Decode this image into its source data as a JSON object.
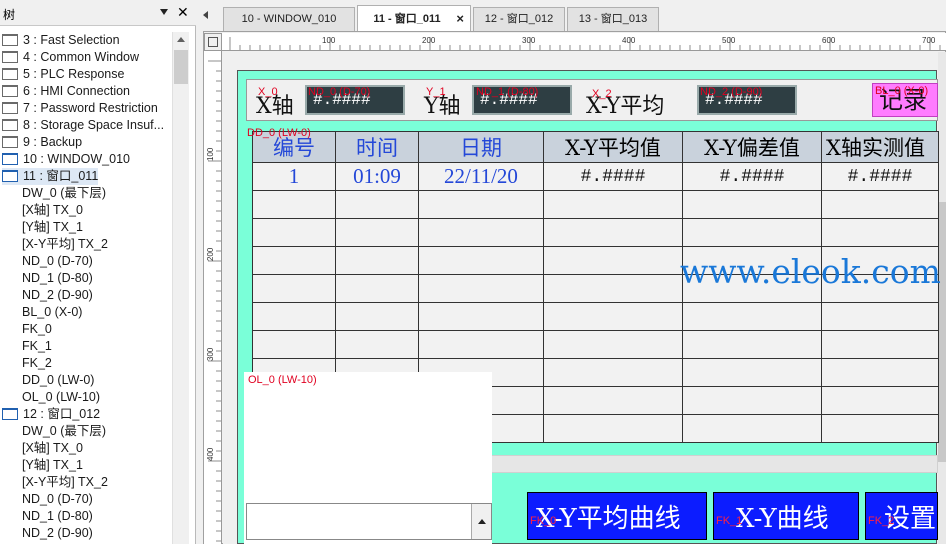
{
  "tree": {
    "title": "树",
    "items": [
      {
        "label": "3 : Fast Selection",
        "level": 0
      },
      {
        "label": "4 : Common Window",
        "level": 0
      },
      {
        "label": "5 : PLC Response",
        "level": 0
      },
      {
        "label": "6 : HMI Connection",
        "level": 0
      },
      {
        "label": "7 : Password Restriction",
        "level": 0
      },
      {
        "label": "8 : Storage Space Insuf...",
        "level": 0
      },
      {
        "label": "9 : Backup",
        "level": 0
      },
      {
        "label": "10 : WINDOW_010",
        "level": 0
      },
      {
        "label": "11 : 窗口_011",
        "level": 0
      },
      {
        "label": "DW_0 (最下层)",
        "level": 1
      },
      {
        "label": "[X轴] TX_0",
        "level": 1
      },
      {
        "label": "[Y轴] TX_1",
        "level": 1
      },
      {
        "label": "[X-Y平均] TX_2",
        "level": 1
      },
      {
        "label": "ND_0 (D-70)",
        "level": 1
      },
      {
        "label": "ND_1 (D-80)",
        "level": 1
      },
      {
        "label": "ND_2 (D-90)",
        "level": 1
      },
      {
        "label": "BL_0 (X-0)",
        "level": 1
      },
      {
        "label": "FK_0",
        "level": 1
      },
      {
        "label": "FK_1",
        "level": 1
      },
      {
        "label": "FK_2",
        "level": 1
      },
      {
        "label": "DD_0 (LW-0)",
        "level": 1
      },
      {
        "label": "OL_0 (LW-10)",
        "level": 1
      },
      {
        "label": "12 : 窗口_012",
        "level": 0
      },
      {
        "label": "DW_0 (最下层)",
        "level": 1
      },
      {
        "label": "[X轴] TX_0",
        "level": 1
      },
      {
        "label": "[Y轴] TX_1",
        "level": 1
      },
      {
        "label": "[X-Y平均] TX_2",
        "level": 1
      },
      {
        "label": "ND_0 (D-70)",
        "level": 1
      },
      {
        "label": "ND_1 (D-80)",
        "level": 1
      },
      {
        "label": "ND_2 (D-90)",
        "level": 1
      }
    ]
  },
  "tabs": [
    {
      "label": "10 - WINDOW_010",
      "active": false
    },
    {
      "label": "11 - 窗口_011",
      "active": true
    },
    {
      "label": "12 - 窗口_012",
      "active": false
    },
    {
      "label": "13 - 窗口_013",
      "active": false
    }
  ],
  "tab_close": "×",
  "ruler": {
    "top_marks": [
      "100",
      "200",
      "300",
      "400",
      "500",
      "600",
      "700",
      "800"
    ],
    "left_marks": [
      "100",
      "200",
      "300",
      "400"
    ]
  },
  "header": {
    "x_label": "X轴",
    "x_tag": "X_0",
    "x_display": "ND_0 (D-70)",
    "x_value": "#.####",
    "y_label": "Y轴",
    "y_tag": "Y_1",
    "y_display": "ND_1 (D-80)",
    "y_value": "#.####",
    "xy_label": "X-Y平均",
    "xy_tag": "X_2",
    "xy_display": "ND_2 (D-90)",
    "xy_value": "#.####",
    "record_label": "记录",
    "record_tag": "BL_0 (X-0)"
  },
  "table": {
    "tag": "DD_0 (LW-0)",
    "columns": [
      "编号",
      "时间",
      "日期",
      "X-Y平均值",
      "X-Y偏差值",
      "X轴实测值"
    ],
    "rows": [
      [
        "1",
        "01:09",
        "22/11/20",
        "#.####",
        "#.####",
        "#.####"
      ]
    ],
    "empty_rows": 9
  },
  "watermark": "www.eleok.com",
  "option_list": {
    "tag": "OL_0 (LW-10)"
  },
  "function_keys": [
    {
      "tag": "FK_0",
      "label": "X-Y平均曲线"
    },
    {
      "tag": "FK_1",
      "label": "X-Y曲线"
    },
    {
      "tag": "FK_2",
      "label": "设置"
    }
  ]
}
